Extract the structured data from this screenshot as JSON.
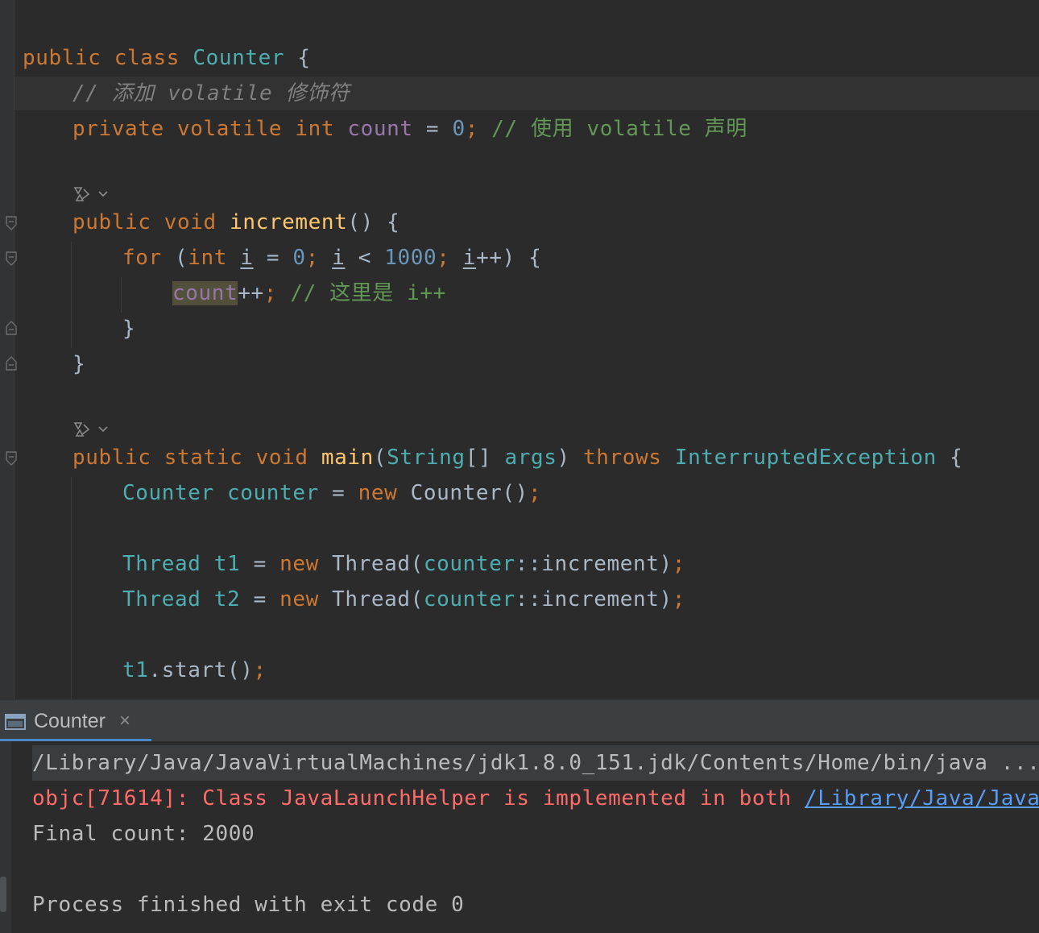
{
  "editor": {
    "l1": {
      "k1": "public",
      "k2": "class",
      "cls": "Counter",
      "brace": "{"
    },
    "l2": {
      "slash": "//",
      "cn": "添加",
      "vol": "volatile",
      "cn2": "修饰符"
    },
    "l3": {
      "k1": "private",
      "k2": "volatile",
      "k3": "int",
      "fld": "count",
      "eq": "=",
      "num": "0",
      "semi": ";",
      "cmt": "// 使用 volatile 声明"
    },
    "l5": {
      "k1": "public",
      "k2": "void",
      "fn": "increment",
      "rest": "() {"
    },
    "l6": {
      "k1": "for",
      "p1": "(",
      "k2": "int",
      "v1": "i",
      "eq": "=",
      "n1": "0",
      "s1": ";",
      "v2": "i",
      "lt": "<",
      "n2": "1000",
      "s2": ";",
      "v3": "i",
      "pp": "++) {"
    },
    "l7": {
      "fld": "count",
      "pp": "++",
      "semi": ";",
      "cmt": "// 这里是 i++"
    },
    "l8": {
      "brace": "}"
    },
    "l9": {
      "brace": "}"
    },
    "l11": {
      "k1": "public",
      "k2": "static",
      "k3": "void",
      "fn": "main",
      "p1": "(",
      "cls1": "String",
      "br": "[]",
      "arg": "args",
      "p2": ")",
      "k4": "throws",
      "cls2": "InterruptedException",
      "brace": "{"
    },
    "l12": {
      "cls": "Counter",
      "var": "counter",
      "eq": "=",
      "k": "new",
      "ctor": "Counter()",
      "semi": ";"
    },
    "l14": {
      "cls": "Thread",
      "var": "t1",
      "eq": "=",
      "k": "new",
      "ctor": "Thread(",
      "ref": "counter",
      "col": "::",
      "m": "increment)",
      "semi": ";"
    },
    "l15": {
      "cls": "Thread",
      "var": "t2",
      "eq": "=",
      "k": "new",
      "ctor": "Thread(",
      "ref": "counter",
      "col": "::",
      "m": "increment)",
      "semi": ";"
    },
    "l17": {
      "var": "t1",
      "call": ".start()",
      "semi": ";"
    }
  },
  "run_panel": {
    "tab_label": "Counter",
    "tab_close": "×"
  },
  "console": {
    "line1": "/Library/Java/JavaVirtualMachines/jdk1.8.0_151.jdk/Contents/Home/bin/java ...",
    "line2_text": "objc[71614]: Class JavaLaunchHelper is implemented in both ",
    "line2_link": "/Library/Java/JavaVir",
    "line3": "Final count: 2000",
    "line5": "Process finished with exit code 0"
  },
  "colors": {
    "background": "#2b2b2b",
    "keyword": "#cc7832",
    "class": "#4eadb0",
    "field": "#9876aa",
    "number": "#6897bb",
    "comment": "#629755",
    "method": "#ffc66d",
    "error": "#ff6b68",
    "link": "#589df6"
  }
}
